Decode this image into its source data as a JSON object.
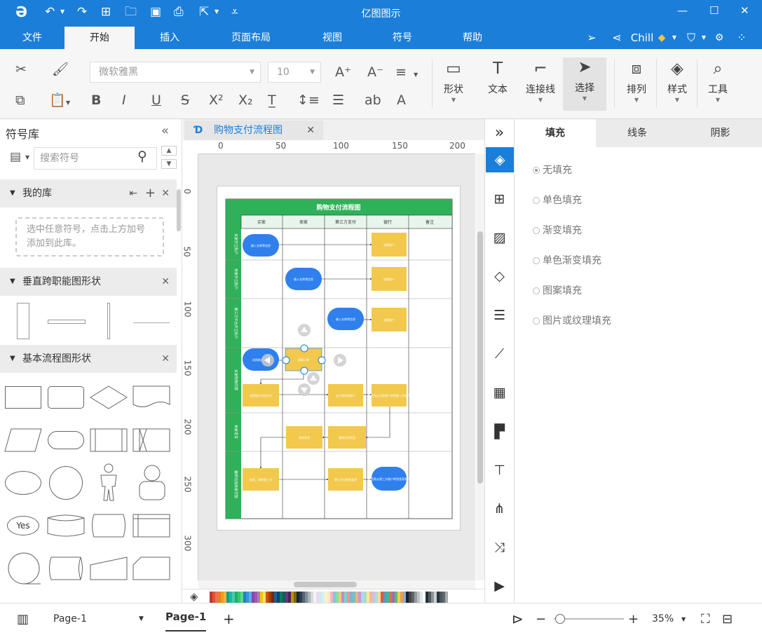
{
  "app": {
    "title": "亿图图示"
  },
  "menu": {
    "items": [
      "文件",
      "开始",
      "插入",
      "页面布局",
      "视图",
      "符号",
      "帮助"
    ],
    "active": "开始"
  },
  "user": {
    "name": "Chill"
  },
  "toolbar": {
    "font_name": "微软雅黑",
    "font_size": "10",
    "shape_label": "形状",
    "text_label": "文本",
    "connector_label": "连接线",
    "select_label": "选择",
    "arrange_label": "排列",
    "style_label": "样式",
    "tools_label": "工具"
  },
  "symbols": {
    "title": "符号库",
    "search_placeholder": "搜索符号",
    "my_library": "我的库",
    "library_hint": "选中任意符号，点击上方加号添加到此库。",
    "vertical_cf": "垂直跨职能图形状",
    "basic_flow": "基本流程图形状",
    "yes_label": "Yes"
  },
  "document": {
    "tab_title": "购物支付流程图"
  },
  "ruler": {
    "top_ticks": [
      "0",
      "50",
      "100",
      "150",
      "200"
    ],
    "left_ticks": [
      "0",
      "50",
      "100",
      "150",
      "200",
      "250",
      "300"
    ]
  },
  "diagram": {
    "title": "购物支付流程图",
    "columns": [
      "买家",
      "卖家",
      "第三方支付",
      "银行",
      "备注"
    ],
    "lanes": [
      "买家开立账户",
      "卖家开立账户",
      "第三方平台开立账户",
      "买家购物付款",
      "卖家发货",
      "最终完成卖家付款"
    ],
    "boxes": {
      "b1": "输入名称等信息",
      "b2": "创建账户",
      "b3": "输入名称等信息",
      "b4": "创建账户",
      "b5": "输入名称等信息",
      "b6": "创建账户",
      "b7": "选购商品",
      "b8": "创建订单",
      "b9": "选择银行完成支付",
      "b10": "支付通知到账户",
      "b11": "将资金从买家账户转到第三方账户",
      "b12": "卖家发货",
      "b13": "通知买家发货",
      "b14": "收货，通知第三方",
      "b15": "第三方付款给卖家",
      "b16": "将货款从第三方账户转到卖家账户"
    },
    "colors": {
      "header_green": "#2eb158",
      "box_yellow": "#f2c94c",
      "oval_blue": "#2f80ed"
    }
  },
  "panel": {
    "tabs": [
      "填充",
      "线条",
      "阴影"
    ],
    "active_tab": "填充",
    "fill_options": [
      "无填充",
      "单色填充",
      "渐变填充",
      "单色渐变填充",
      "图案填充",
      "图片或纹理填充"
    ],
    "selected": "无填充"
  },
  "status": {
    "page_selector": "Page-1",
    "page_tab": "Page-1",
    "zoom": "35%"
  }
}
